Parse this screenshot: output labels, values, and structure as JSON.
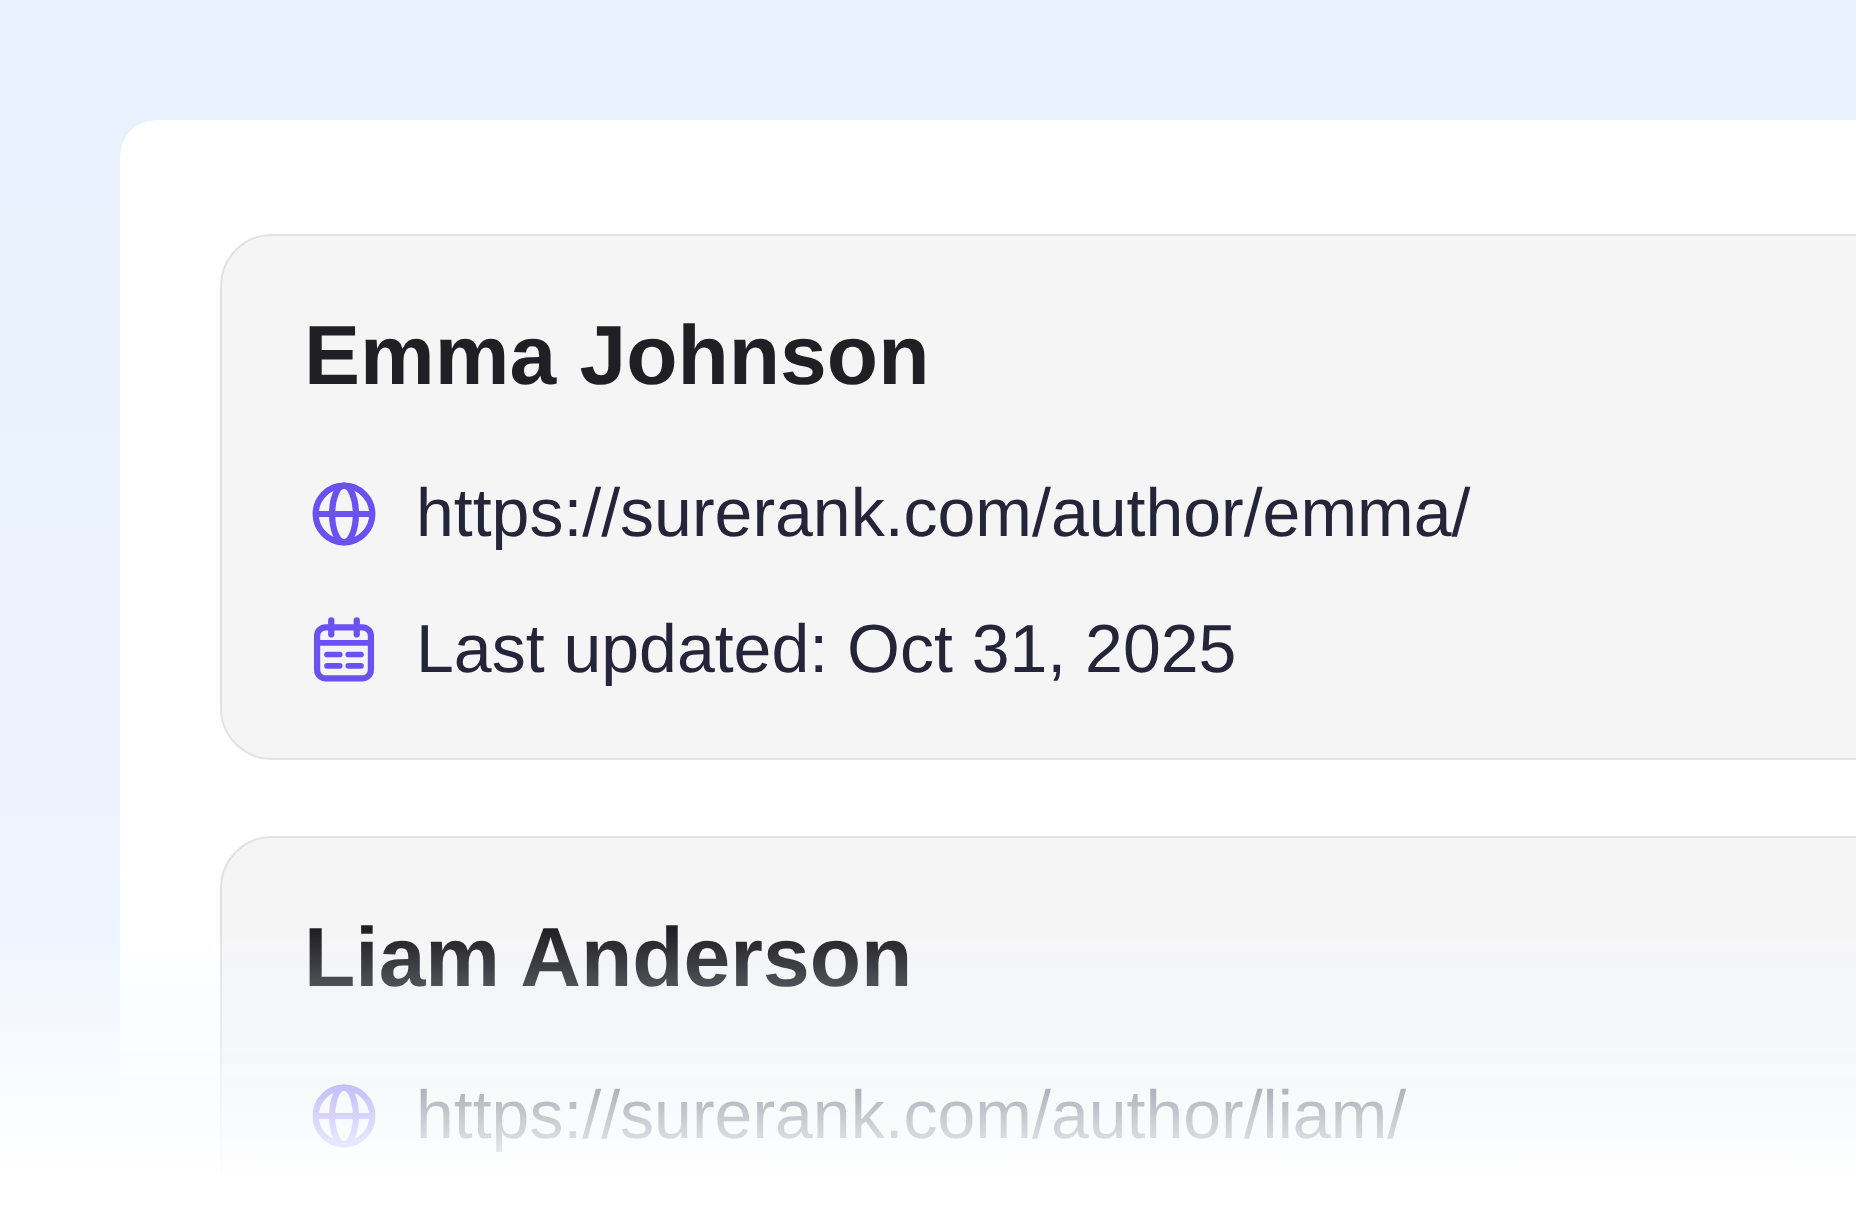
{
  "authors": [
    {
      "name": "Emma Johnson",
      "details": [
        {
          "kind": "url",
          "text": "https://surerank.com/author/emma/"
        },
        {
          "kind": "date",
          "text": "Last updated: Oct 31, 2025"
        }
      ]
    },
    {
      "name": "Liam Anderson",
      "details": [
        {
          "kind": "url",
          "text": "https://surerank.com/author/liam/"
        }
      ]
    }
  ]
}
